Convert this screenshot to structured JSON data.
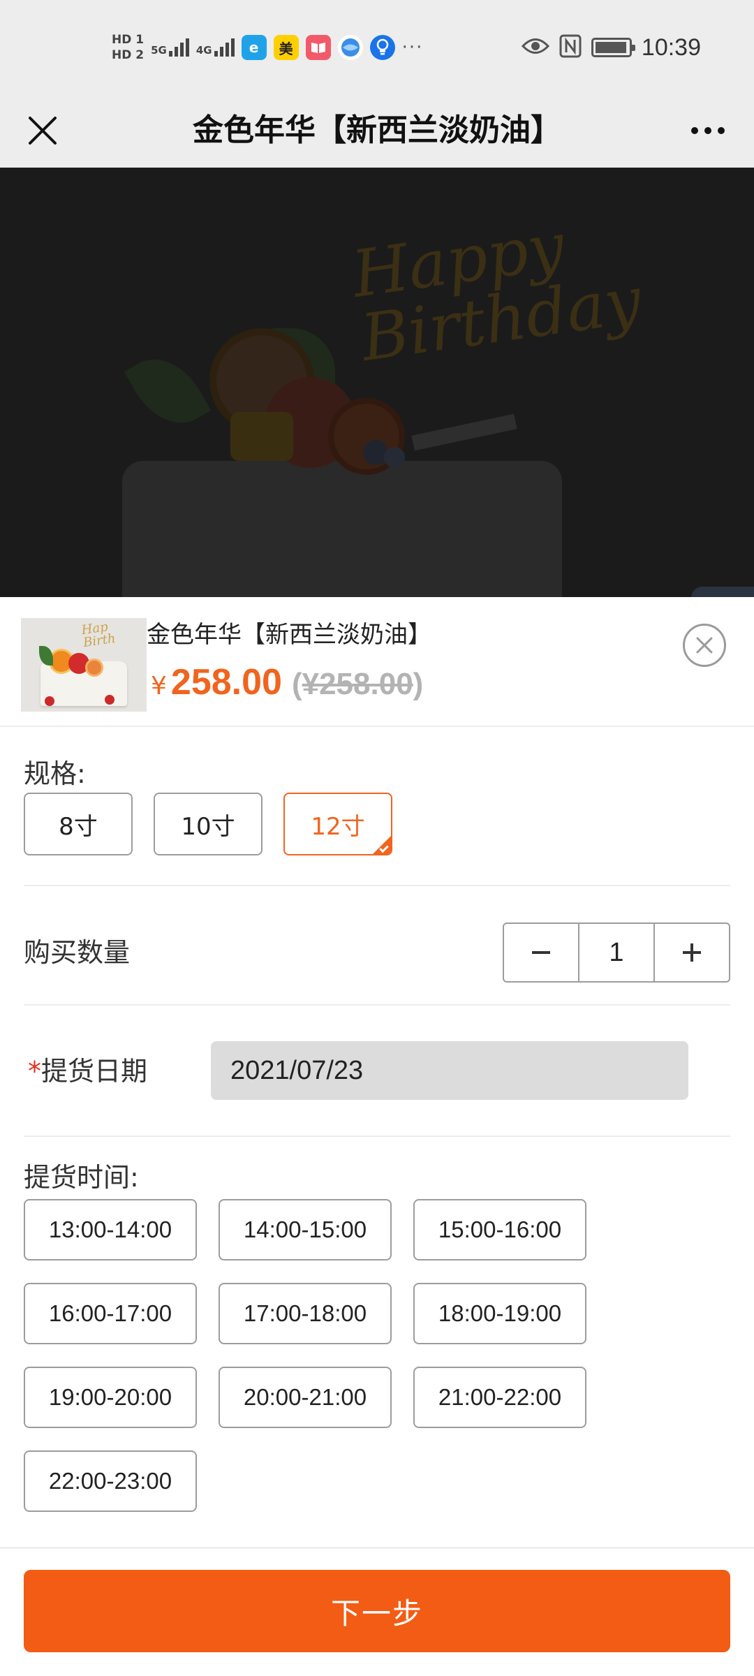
{
  "status_bar": {
    "hd1": "HD 1",
    "hd2": "HD 2",
    "net1": "5G",
    "net2": "4G",
    "app_mei": "美",
    "more": "···",
    "time": "10:39",
    "icons": [
      "eye-icon",
      "nfc-icon",
      "battery-icon"
    ]
  },
  "header": {
    "title": "金色年华【新西兰淡奶油】"
  },
  "product": {
    "name": "金色年华【新西兰淡奶油】",
    "currency": "¥",
    "price": "258.00",
    "old_price_open": "(",
    "old_price": "¥258.00",
    "old_price_close": ")"
  },
  "spec": {
    "label": "规格:",
    "options": [
      "8寸",
      "10寸",
      "12寸"
    ],
    "selected": "12寸"
  },
  "quantity": {
    "label": "购买数量",
    "value": "1"
  },
  "pickup_date": {
    "required_mark": "*",
    "label": "提货日期",
    "value": "2021/07/23"
  },
  "pickup_time": {
    "label": "提货时间:",
    "slots": [
      "13:00-14:00",
      "14:00-15:00",
      "15:00-16:00",
      "16:00-17:00",
      "17:00-18:00",
      "18:00-19:00",
      "19:00-20:00",
      "20:00-21:00",
      "21:00-22:00",
      "22:00-23:00"
    ]
  },
  "footer": {
    "next_label": "下一步"
  },
  "colors": {
    "accent": "#f0641e",
    "next_button": "#f25c14",
    "required": "#e03020",
    "header_bg": "#ededed"
  }
}
